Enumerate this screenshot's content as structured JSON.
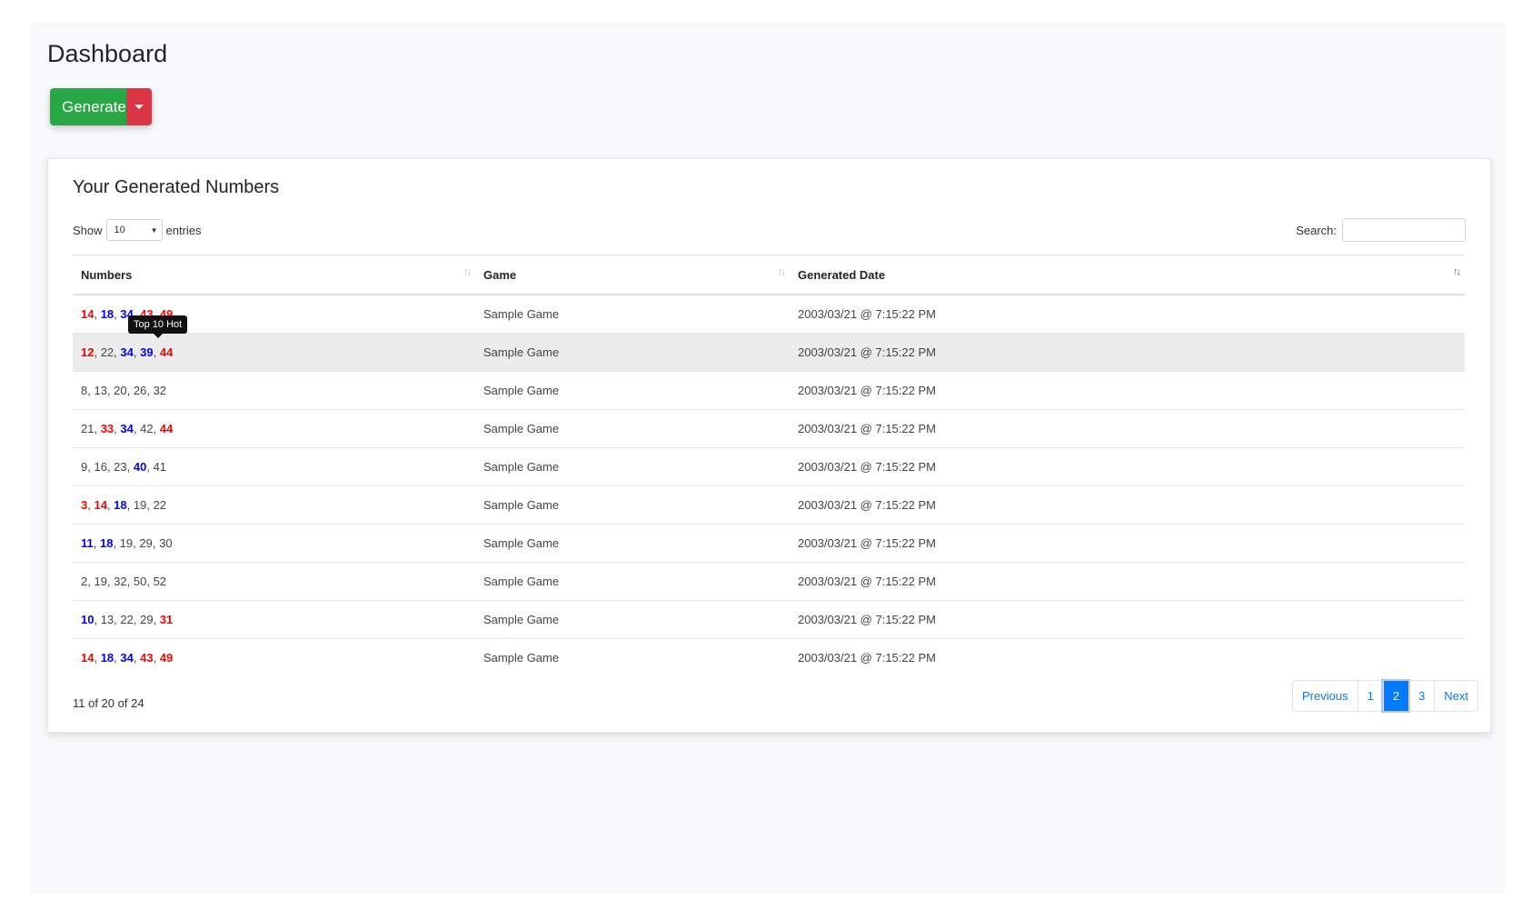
{
  "page": {
    "title": "Dashboard"
  },
  "toolbar": {
    "generate_label": "Generate",
    "dropdown_icon": "caret-down-icon"
  },
  "colors": {
    "hot": "#ff0000",
    "cold": "#0000ff",
    "generate": "#28a745",
    "dropdown": "#dc3545",
    "accent": "#007bff"
  },
  "card": {
    "title": "Your Generated Numbers",
    "show_label": "Show",
    "entries_value": "10",
    "entries_label": "entries",
    "search_label": "Search:",
    "search_value": ""
  },
  "table": {
    "columns": [
      "Numbers",
      "Game",
      "Generated Date"
    ],
    "rows": [
      {
        "numbers": [
          {
            "n": "14",
            "t": "hot"
          },
          {
            "n": "18",
            "t": "cold"
          },
          {
            "n": "34",
            "t": "cold"
          },
          {
            "n": "43",
            "t": "hot"
          },
          {
            "n": "49",
            "t": "hot"
          }
        ],
        "game": "Sample Game",
        "date": "2003/03/21 @ 7:15:22 PM"
      },
      {
        "numbers": [
          {
            "n": "12",
            "t": "hot"
          },
          {
            "n": "22",
            "t": ""
          },
          {
            "n": "34",
            "t": "cold"
          },
          {
            "n": "39",
            "t": "cold"
          },
          {
            "n": "44",
            "t": "hot"
          }
        ],
        "game": "Sample Game",
        "date": "2003/03/21 @ 7:15:22 PM"
      },
      {
        "numbers": [
          {
            "n": "8",
            "t": ""
          },
          {
            "n": "13",
            "t": ""
          },
          {
            "n": "20",
            "t": ""
          },
          {
            "n": "26",
            "t": ""
          },
          {
            "n": "32",
            "t": ""
          }
        ],
        "game": "Sample Game",
        "date": "2003/03/21 @ 7:15:22 PM"
      },
      {
        "numbers": [
          {
            "n": "21",
            "t": ""
          },
          {
            "n": "33",
            "t": "hot"
          },
          {
            "n": "34",
            "t": "cold"
          },
          {
            "n": "42",
            "t": ""
          },
          {
            "n": "44",
            "t": "hot"
          }
        ],
        "game": "Sample Game",
        "date": "2003/03/21 @ 7:15:22 PM"
      },
      {
        "numbers": [
          {
            "n": "9",
            "t": ""
          },
          {
            "n": "16",
            "t": ""
          },
          {
            "n": "23",
            "t": ""
          },
          {
            "n": "40",
            "t": "cold"
          },
          {
            "n": "41",
            "t": ""
          }
        ],
        "game": "Sample Game",
        "date": "2003/03/21 @ 7:15:22 PM"
      },
      {
        "numbers": [
          {
            "n": "3",
            "t": "hot"
          },
          {
            "n": "14",
            "t": "hot"
          },
          {
            "n": "18",
            "t": "cold"
          },
          {
            "n": "19",
            "t": ""
          },
          {
            "n": "22",
            "t": ""
          }
        ],
        "game": "Sample Game",
        "date": "2003/03/21 @ 7:15:22 PM"
      },
      {
        "numbers": [
          {
            "n": "11",
            "t": "cold"
          },
          {
            "n": "18",
            "t": "cold"
          },
          {
            "n": "19",
            "t": ""
          },
          {
            "n": "29",
            "t": ""
          },
          {
            "n": "30",
            "t": ""
          }
        ],
        "game": "Sample Game",
        "date": "2003/03/21 @ 7:15:22 PM"
      },
      {
        "numbers": [
          {
            "n": "2",
            "t": ""
          },
          {
            "n": "19",
            "t": ""
          },
          {
            "n": "32",
            "t": ""
          },
          {
            "n": "50",
            "t": ""
          },
          {
            "n": "52",
            "t": ""
          }
        ],
        "game": "Sample Game",
        "date": "2003/03/21 @ 7:15:22 PM"
      },
      {
        "numbers": [
          {
            "n": "10",
            "t": "cold"
          },
          {
            "n": "13",
            "t": ""
          },
          {
            "n": "22",
            "t": ""
          },
          {
            "n": "29",
            "t": ""
          },
          {
            "n": "31",
            "t": "hot"
          }
        ],
        "game": "Sample Game",
        "date": "2003/03/21 @ 7:15:22 PM"
      },
      {
        "numbers": [
          {
            "n": "14",
            "t": "hot"
          },
          {
            "n": "18",
            "t": "cold"
          },
          {
            "n": "34",
            "t": "cold"
          },
          {
            "n": "43",
            "t": "hot"
          },
          {
            "n": "49",
            "t": "hot"
          }
        ],
        "game": "Sample Game",
        "date": "2003/03/21 @ 7:15:22 PM"
      }
    ]
  },
  "tooltip": {
    "text": "Top 10 Hot"
  },
  "footer": {
    "info": "11 of 20 of 24",
    "pagination": {
      "previous": "Previous",
      "pages": [
        "1",
        "2",
        "3"
      ],
      "current": "2",
      "next": "Next"
    }
  }
}
